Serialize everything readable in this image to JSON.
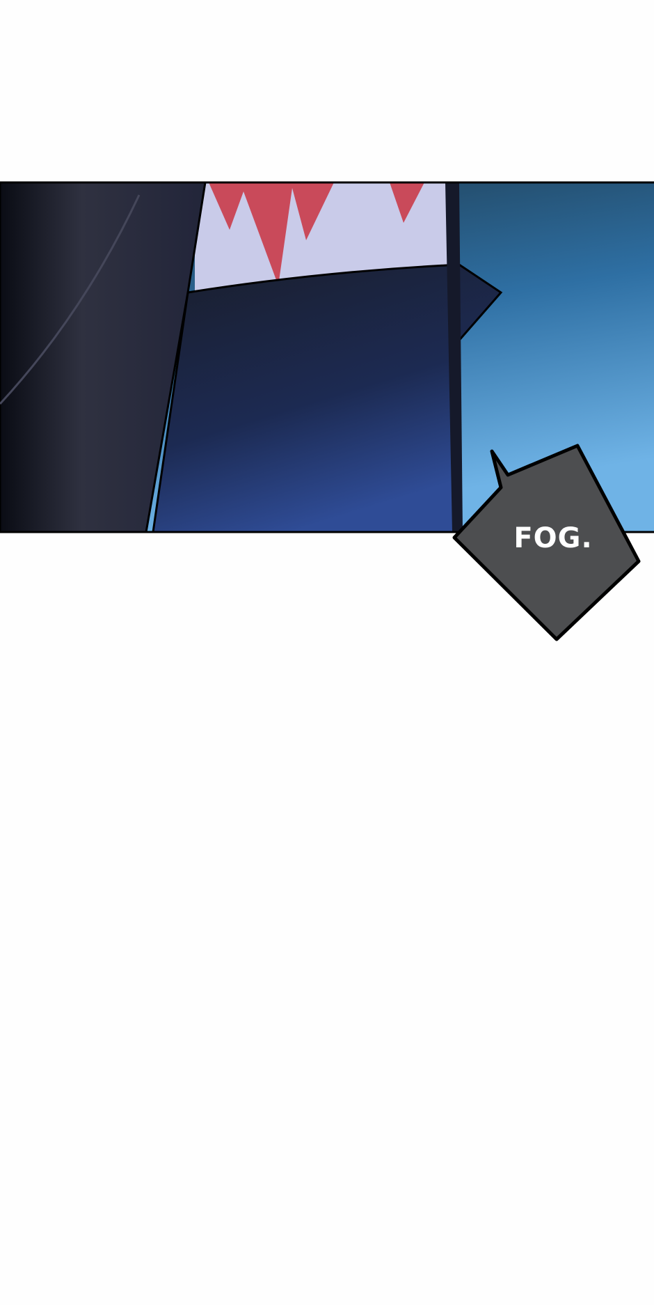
{
  "comic": {
    "speech_bubble": {
      "text": "FOG."
    },
    "colors": {
      "background": "#fefefe",
      "sky_top": "#1e3b4f",
      "sky_bottom": "#6fb3e6",
      "cloak": "#1c2236",
      "bubble": "#4d4e50",
      "hair": "#c94a5a"
    }
  }
}
